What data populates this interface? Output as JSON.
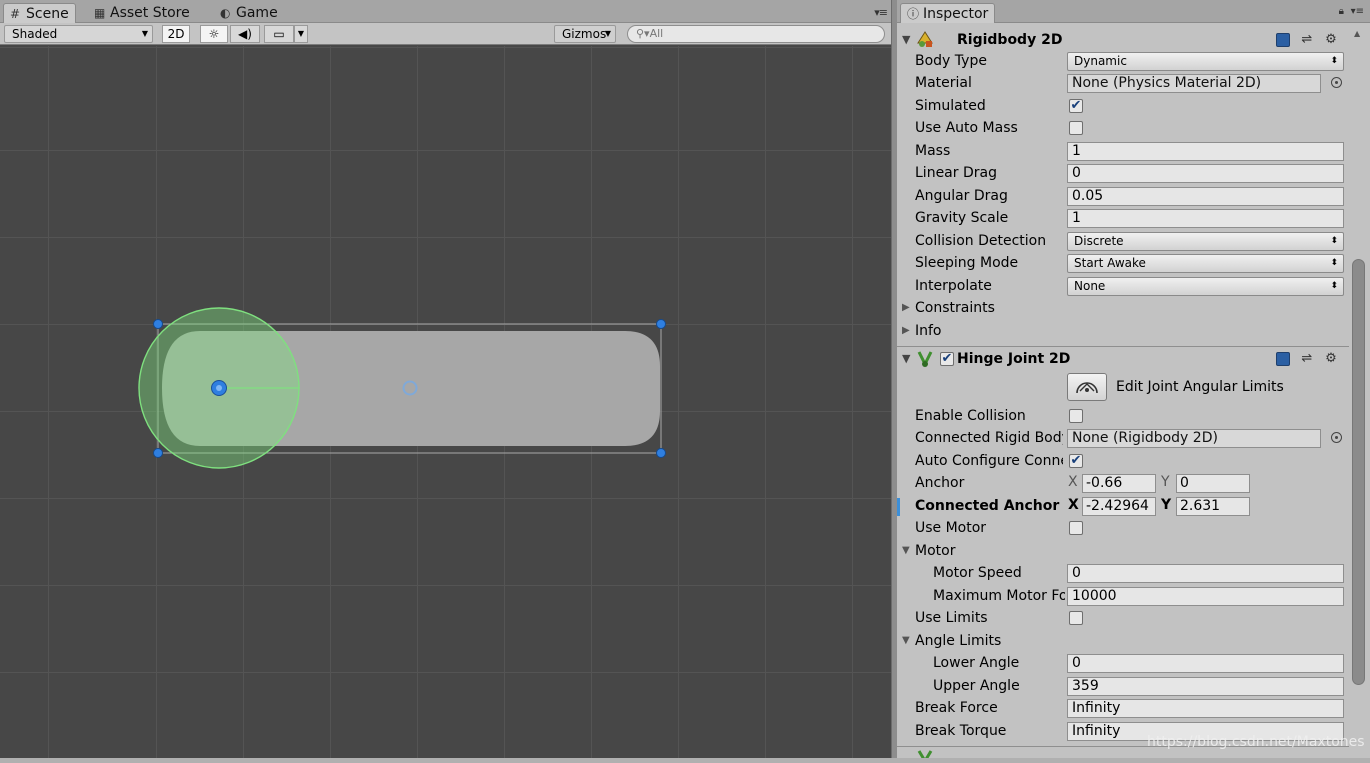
{
  "scene_panel": {
    "tabs": [
      {
        "label": "Scene",
        "icon": "grid-icon"
      },
      {
        "label": "Asset Store",
        "icon": "store-icon"
      },
      {
        "label": "Game",
        "icon": "game-icon"
      }
    ],
    "toolbar": {
      "shading_mode": "Shaded",
      "two_d_label": "2D",
      "gizmos_label": "Gizmos",
      "search_placeholder": "All"
    }
  },
  "inspector": {
    "tab_label": "Inspector",
    "rigidbody": {
      "title": "Rigidbody 2D",
      "body_type": {
        "label": "Body Type",
        "value": "Dynamic"
      },
      "material": {
        "label": "Material",
        "value": "None (Physics Material 2D)"
      },
      "simulated": {
        "label": "Simulated",
        "checked": "✔"
      },
      "use_auto_mass": {
        "label": "Use Auto Mass",
        "checked": ""
      },
      "mass": {
        "label": "Mass",
        "value": "1"
      },
      "linear_drag": {
        "label": "Linear Drag",
        "value": "0"
      },
      "angular_drag": {
        "label": "Angular Drag",
        "value": "0.05"
      },
      "gravity_scale": {
        "label": "Gravity Scale",
        "value": "1"
      },
      "collision_detection": {
        "label": "Collision Detection",
        "value": "Discrete"
      },
      "sleeping_mode": {
        "label": "Sleeping Mode",
        "value": "Start Awake"
      },
      "interpolate": {
        "label": "Interpolate",
        "value": "None"
      },
      "constraints": {
        "label": "Constraints"
      },
      "info": {
        "label": "Info"
      }
    },
    "hinge": {
      "title": "Hinge Joint 2D",
      "enabled": "✔",
      "edit_limits_label": "Edit Joint Angular Limits",
      "enable_collision": {
        "label": "Enable Collision",
        "checked": ""
      },
      "connected_rigid_body": {
        "label": "Connected Rigid Body",
        "value": "None (Rigidbody 2D)"
      },
      "auto_configure": {
        "label": "Auto Configure Connected Anchor",
        "checked": "✔"
      },
      "anchor": {
        "label": "Anchor",
        "x_label": "X",
        "x": "-0.66",
        "y_label": "Y",
        "y": "0"
      },
      "connected_anchor": {
        "label": "Connected Anchor",
        "x_label": "X",
        "x": "-2.42964",
        "y_label": "Y",
        "y": "2.631"
      },
      "use_motor": {
        "label": "Use Motor",
        "checked": ""
      },
      "motor": {
        "label": "Motor"
      },
      "motor_speed": {
        "label": "Motor Speed",
        "value": "0"
      },
      "max_motor_force": {
        "label": "Maximum Motor Force",
        "value": "10000"
      },
      "use_limits": {
        "label": "Use Limits",
        "checked": ""
      },
      "angle_limits": {
        "label": "Angle Limits"
      },
      "lower_angle": {
        "label": "Lower Angle",
        "value": "0"
      },
      "upper_angle": {
        "label": "Upper Angle",
        "value": "359"
      },
      "break_force": {
        "label": "Break Force",
        "value": "Infinity"
      },
      "break_torque": {
        "label": "Break Torque",
        "value": "Infinity"
      }
    }
  },
  "watermark": "https://blog.csdn.net/Maxtones",
  "colors": {
    "scene_bg": "#474747",
    "collider_green": "#7fe07f",
    "handle_blue": "#2f7fe0",
    "checkbox_check": "#183f7a"
  }
}
